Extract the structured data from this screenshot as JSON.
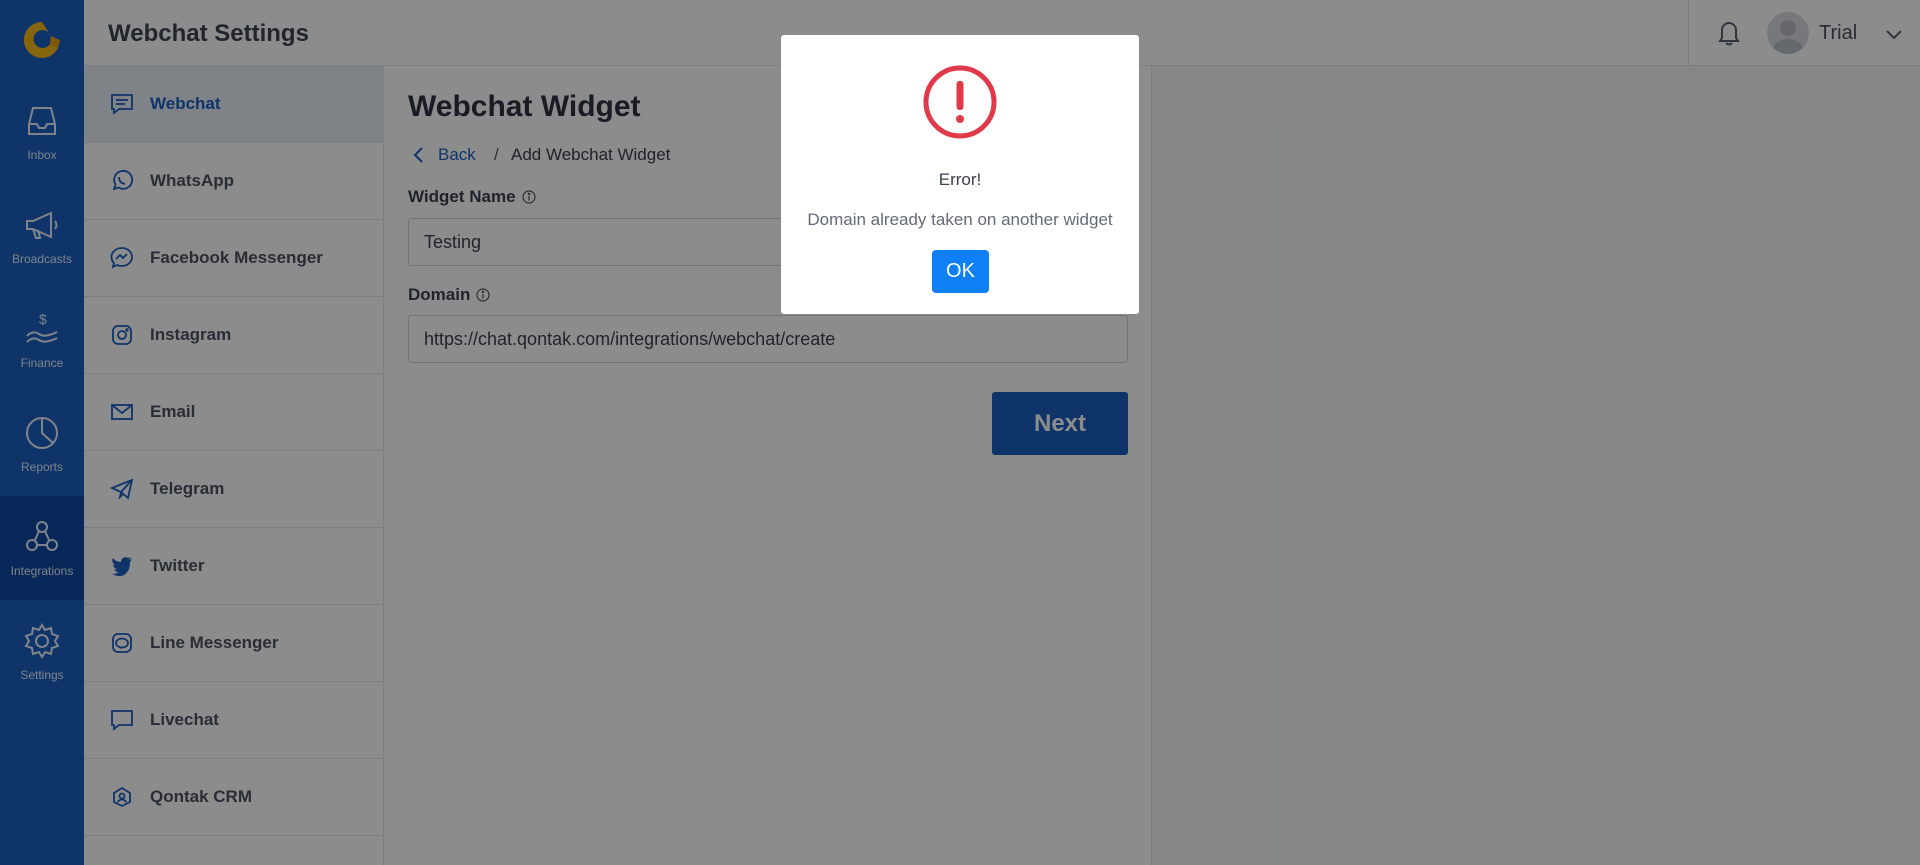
{
  "header": {
    "title": "Webchat Settings",
    "user_name": "Trial"
  },
  "rail": {
    "items": [
      {
        "label": "Inbox",
        "icon": "inbox-icon"
      },
      {
        "label": "Broadcasts",
        "icon": "megaphone-icon"
      },
      {
        "label": "Finance",
        "icon": "finance-icon"
      },
      {
        "label": "Reports",
        "icon": "pie-chart-icon"
      },
      {
        "label": "Integrations",
        "icon": "integrations-icon",
        "active": true
      },
      {
        "label": "Settings",
        "icon": "gear-icon"
      }
    ]
  },
  "channels": [
    {
      "label": "Webchat",
      "icon": "webchat-icon",
      "active": true
    },
    {
      "label": "WhatsApp",
      "icon": "whatsapp-icon"
    },
    {
      "label": "Facebook Messenger",
      "icon": "messenger-icon"
    },
    {
      "label": "Instagram",
      "icon": "instagram-icon"
    },
    {
      "label": "Email",
      "icon": "email-icon"
    },
    {
      "label": "Telegram",
      "icon": "telegram-icon"
    },
    {
      "label": "Twitter",
      "icon": "twitter-icon"
    },
    {
      "label": "Line Messenger",
      "icon": "line-icon"
    },
    {
      "label": "Livechat",
      "icon": "livechat-icon"
    },
    {
      "label": "Qontak CRM",
      "icon": "crm-icon"
    }
  ],
  "main": {
    "heading": "Webchat Widget",
    "breadcrumb": {
      "back": "Back",
      "separator": "/",
      "current": "Add Webchat Widget"
    },
    "widget_name": {
      "label": "Widget Name",
      "value": "Testing"
    },
    "domain": {
      "label": "Domain",
      "value": "https://chat.qontak.com/integrations/webchat/create"
    },
    "next_label": "Next"
  },
  "modal": {
    "title": "Error!",
    "message": "Domain already taken on another widget",
    "ok_label": "OK",
    "icon": "error-icon"
  },
  "colors": {
    "brand": "#1b5fc1",
    "rail_active": "#0f4aa3",
    "error": "#e03a4a",
    "ok_button": "#0f7ff5",
    "logo_accent": "#f5b81c"
  }
}
